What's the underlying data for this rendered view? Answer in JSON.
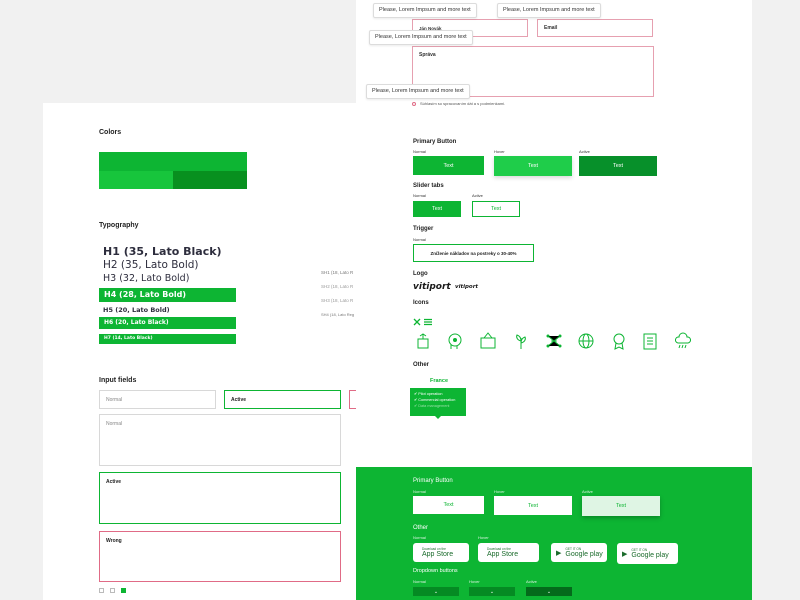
{
  "tooltips": {
    "t1": "Please, Lorem Impsum and more text",
    "t2": "Please, Lorem Impsum and more text",
    "t3": "Please, Lorem Impsum and more text",
    "t4": "Please, Lorem Impsum and more text"
  },
  "form": {
    "name": "Ján Novák",
    "email": "Email",
    "message": "Správa",
    "consent": "Súhlasím so spracovaním dát a s podmienkami."
  },
  "sections": {
    "colors": "Colors",
    "typography": "Typography",
    "inputs": "Input fields",
    "primary": "Primary Button",
    "slider": "Slider tabs",
    "trigger": "Trigger",
    "logo": "Logo",
    "icons": "Icons",
    "other": "Other"
  },
  "colors": {
    "swatch_main": "#0db533",
    "swatch_light": "#15c23a",
    "swatch_dark": "#08901f"
  },
  "typography": {
    "h1": "H1 (35, Lato Black)",
    "h2": "H2 (35, Lato Bold)",
    "h3": "H3 (32, Lato Bold)",
    "h4": "H4 (28, Lato Bold)",
    "h5": "H5 (20, Lato Bold)",
    "h6": "H6 (20, Lato Black)",
    "h7": "H7 (14, Lato Black)",
    "sh1": "SH1 (18, Lato R",
    "sh2": "SH2 (18, Lato R",
    "sh3": "SH3 (18, Lato R",
    "sh4": "SH4 (18, Lato Reg"
  },
  "inputs": {
    "normal": "Normal",
    "active": "Active",
    "textarea_normal": "Normal",
    "textarea_active": "Active",
    "textarea_wrong": "Wrong"
  },
  "buttons": {
    "state_normal": "Normal",
    "state_hover": "Hover",
    "state_active": "Active",
    "text": "Text"
  },
  "trigger": {
    "state": "Normal",
    "label": "Zníženie nákladov na postreky o 30-40%"
  },
  "logo": {
    "big": "vitiport",
    "small": "vitiport"
  },
  "other": {
    "country": "France",
    "menu": [
      "Pilot operation",
      "Commercial operation",
      "Data management"
    ]
  },
  "green": {
    "primary": "Primary Button",
    "other": "Other",
    "dropdowns": "Dropdown buttons",
    "normal": "Normal",
    "hover": "Hover",
    "active": "Active",
    "text": "Text",
    "appstore_small": "Download on the",
    "appstore_big": "App Store",
    "gplay_small": "GET IT ON",
    "gplay_big": "Google play"
  },
  "icons": [
    "check-cross-icon",
    "menu-icon",
    "hand-plant-icon",
    "head-idea-icon",
    "wallet-icon",
    "plant-icon",
    "network-icon",
    "globe-icon",
    "award-icon",
    "checklist-icon",
    "cloud-rain-icon"
  ]
}
